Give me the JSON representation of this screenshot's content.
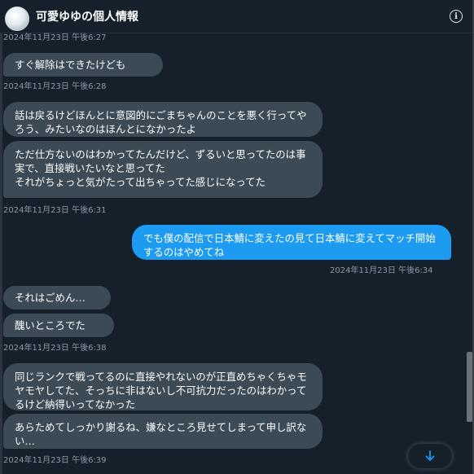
{
  "header": {
    "title": "可愛ゆゆの個人情報",
    "info_icon": "info-icon",
    "info_glyph": "i"
  },
  "messages": [
    {
      "kind": "timestamp",
      "text": "2024年11月23日 午後6:27"
    },
    {
      "kind": "received",
      "text": "すぐ解除はできたけども"
    },
    {
      "kind": "timestamp",
      "text": "2024年11月23日 午後6:28"
    },
    {
      "kind": "received",
      "text": "話は戻るけどほんとに意図的にごまちゃんのことを悪く行ってやろう、みたいなのはほんとになかったよ"
    },
    {
      "kind": "received",
      "text": "ただ仕方ないのはわかってたんだけど、ずるいと思ってたのは事実で、直接戦いたいなと思ってた\nそれがちょっと気がたって出ちゃってた感じになってた"
    },
    {
      "kind": "timestamp",
      "text": "2024年11月23日 午後6:31"
    },
    {
      "kind": "sent",
      "text": "でも僕の配信で日本鯖に変えたの見て日本鯖に変えてマッチ開始するのはやめてね"
    },
    {
      "kind": "timestamp",
      "text": "2024年11月23日 午後6:34"
    },
    {
      "kind": "received",
      "text": "それはごめん…"
    },
    {
      "kind": "received",
      "text": "醜いところでた"
    },
    {
      "kind": "timestamp",
      "text": "2024年11月23日 午後6:38"
    },
    {
      "kind": "received",
      "text": "同じランクで戦ってるのに直接やれないのが正直めちゃくちゃモヤモヤしてた、そっちに非はないし不可抗力だったのはわかってるけど納得いってなかった"
    },
    {
      "kind": "received",
      "text": "あらためてしっかり謝るね、嫌なところ見せてしまって申し訳ない…"
    },
    {
      "kind": "timestamp",
      "text": "2024年11月23日 午後6:39"
    }
  ],
  "scroll_down_icon": "arrow-down-icon",
  "colors": {
    "background": "#15202b",
    "received_bubble": "#3b4a55",
    "sent_bubble": "#1d9bf0",
    "timestamp": "#8b98a5",
    "accent": "#1d9bf0"
  }
}
